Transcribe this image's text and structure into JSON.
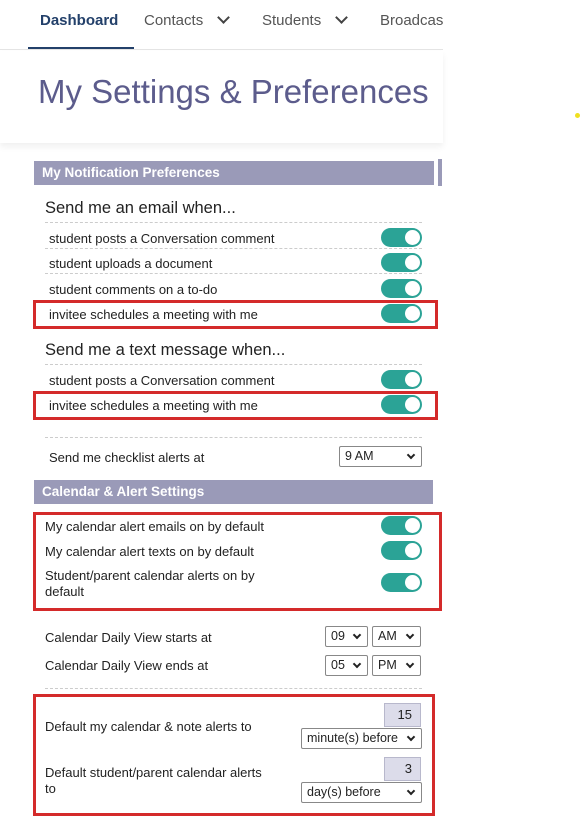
{
  "nav": {
    "items": [
      {
        "label": "Dashboard",
        "active": true
      },
      {
        "label": "Contacts",
        "has_dropdown": true
      },
      {
        "label": "Students",
        "has_dropdown": true
      },
      {
        "label": "Broadcast"
      }
    ]
  },
  "page_title": "My Settings & Preferences",
  "notification_prefs": {
    "header": "My Notification Preferences",
    "email_group": {
      "title": "Send me an email when...",
      "items": [
        {
          "label": "student posts a Conversation comment",
          "on": true
        },
        {
          "label": "student uploads a document",
          "on": true
        },
        {
          "label": "student comments on a to-do",
          "on": true
        },
        {
          "label": "invitee schedules a meeting with me",
          "on": true
        }
      ]
    },
    "text_group": {
      "title": "Send me a text message when...",
      "items": [
        {
          "label": "student posts a Conversation comment",
          "on": true
        },
        {
          "label": "invitee schedules a meeting with me",
          "on": true
        }
      ]
    },
    "checklist": {
      "label": "Send me checklist alerts at",
      "value": "9 AM"
    }
  },
  "calendar_settings": {
    "header": "Calendar & Alert Settings",
    "toggles": [
      {
        "label": "My calendar alert emails on by default",
        "on": true
      },
      {
        "label": "My calendar alert texts on by default",
        "on": true
      },
      {
        "label": "Student/parent calendar alerts on by default",
        "on": true
      }
    ],
    "daily_start": {
      "label": "Calendar Daily View starts at",
      "hour": "09",
      "ampm": "AM"
    },
    "daily_end": {
      "label": "Calendar Daily View ends at",
      "hour": "05",
      "ampm": "PM"
    },
    "my_alerts": {
      "label": "Default my calendar & note alerts to",
      "amount": "15",
      "unit": "minute(s) before"
    },
    "student_alerts": {
      "label": "Default student/parent calendar alerts to",
      "amount": "3",
      "unit": "day(s) before"
    }
  },
  "colors": {
    "accent_nav": "#23406a",
    "title": "#5c5c8c",
    "section_header": "#9a9ab8",
    "toggle_on": "#2ba396",
    "highlight_box": "#d42a2a"
  }
}
